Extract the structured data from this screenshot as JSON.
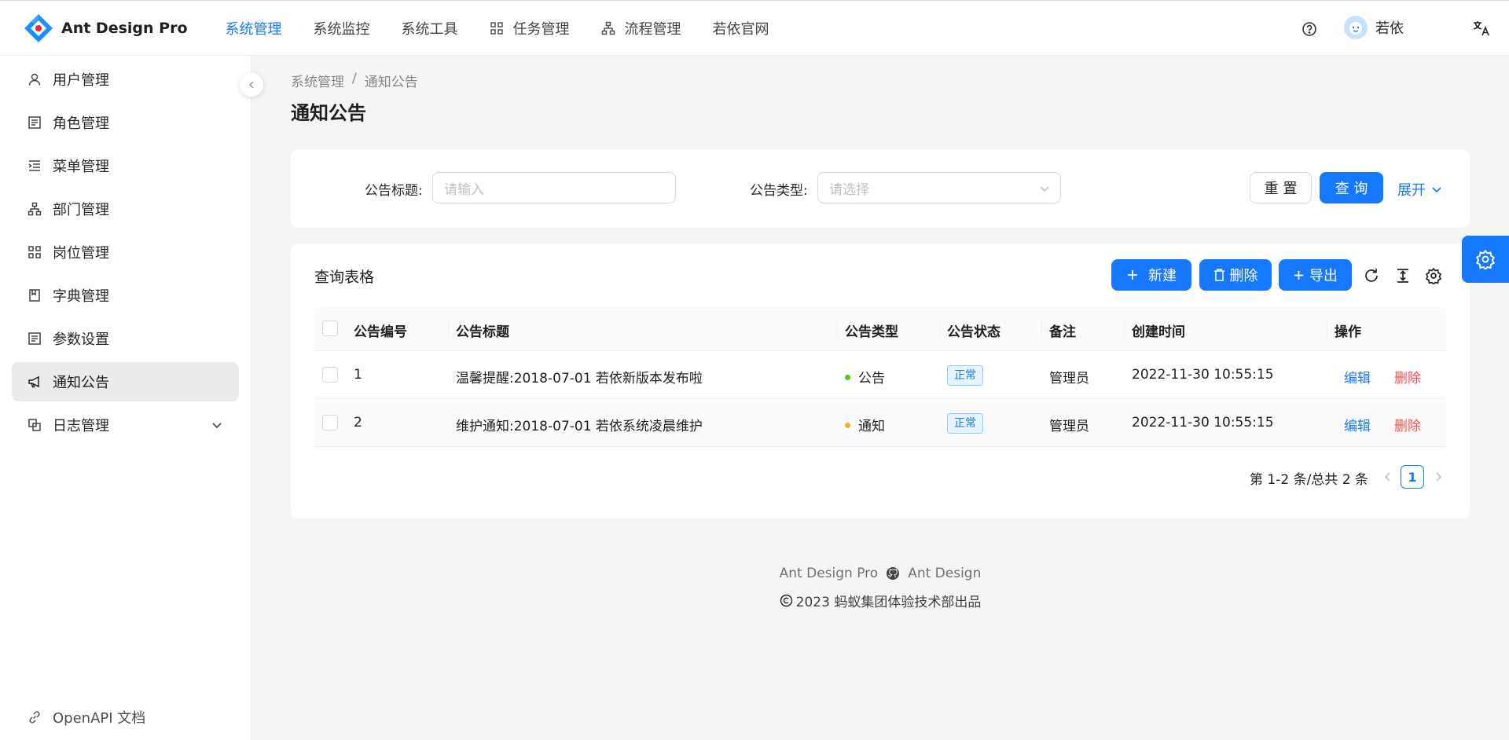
{
  "app": {
    "title": "Ant Design Pro"
  },
  "top_nav": [
    {
      "label": "系统管理",
      "active": true
    },
    {
      "label": "系统监控"
    },
    {
      "label": "系统工具"
    },
    {
      "label": "任务管理",
      "icon": "appstore-icon"
    },
    {
      "label": "流程管理",
      "icon": "apartment-icon"
    },
    {
      "label": "若依官网"
    }
  ],
  "user": {
    "name": "若依"
  },
  "sidebar": {
    "items": [
      {
        "label": "用户管理",
        "icon": "user-icon"
      },
      {
        "label": "角色管理",
        "icon": "profile-icon"
      },
      {
        "label": "菜单管理",
        "icon": "menu-icon"
      },
      {
        "label": "部门管理",
        "icon": "apartment-icon"
      },
      {
        "label": "岗位管理",
        "icon": "appstore-icon"
      },
      {
        "label": "字典管理",
        "icon": "book-icon"
      },
      {
        "label": "参数设置",
        "icon": "profile-icon"
      },
      {
        "label": "通知公告",
        "icon": "notification-icon",
        "selected": true
      },
      {
        "label": "日志管理",
        "icon": "copy-icon",
        "expandable": true
      }
    ],
    "bottom": {
      "label": "OpenAPI 文档",
      "icon": "link-icon"
    }
  },
  "breadcrumb": {
    "parent": "系统管理",
    "separator": "/",
    "current": "通知公告"
  },
  "page_title": "通知公告",
  "search": {
    "title_label": "公告标题:",
    "title_placeholder": "请输入",
    "type_label": "公告类型:",
    "type_placeholder": "请选择",
    "reset_label": "重 置",
    "query_label": "查 询",
    "expand_label": "展开"
  },
  "table": {
    "title": "查询表格",
    "actions": {
      "new": "新建",
      "delete": "删除",
      "export": "导出"
    },
    "columns": [
      "公告编号",
      "公告标题",
      "公告类型",
      "公告状态",
      "备注",
      "创建时间",
      "操作"
    ],
    "rows": [
      {
        "id": "1",
        "title": "温馨提醒:2018-07-01 若依新版本发布啦",
        "type": "公告",
        "type_color": "#52c41a",
        "status": "正常",
        "remark": "管理员",
        "created": "2022-11-30 10:55:15",
        "edit": "编辑",
        "delete": "删除"
      },
      {
        "id": "2",
        "title": "维护通知:2018-07-01 若依系统凌晨维护",
        "type": "通知",
        "type_color": "#faad14",
        "status": "正常",
        "remark": "管理员",
        "created": "2022-11-30 10:55:15",
        "edit": "编辑",
        "delete": "删除"
      }
    ],
    "pagination": {
      "summary": "第 1-2 条/总共 2 条",
      "current_page": "1"
    }
  },
  "footer": {
    "link1": "Ant Design Pro",
    "link2": "Ant Design",
    "copyright": "2023 蚂蚁集团体验技术部出品"
  },
  "colors": {
    "primary": "#1677ff",
    "danger": "#ff4d4f"
  }
}
